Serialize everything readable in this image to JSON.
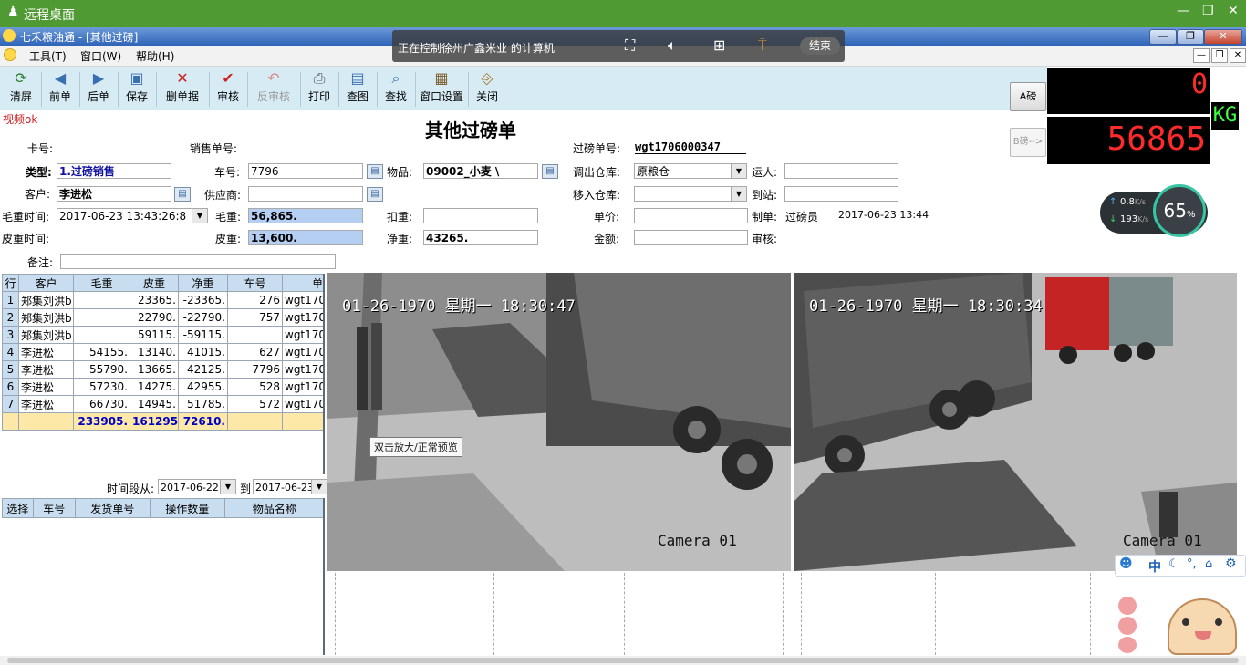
{
  "remote_desktop": {
    "title": "远程桌面",
    "minimize": "—",
    "restore": "❐",
    "close": "✕"
  },
  "app": {
    "title": "七禾粮油通 - [其他过磅]"
  },
  "remote_overlay": {
    "message": "正在控制徐州广鑫米业 的计算机",
    "end_label": "结束"
  },
  "menu": {
    "items": [
      "工具(T)",
      "窗口(W)",
      "帮助(H)"
    ]
  },
  "toolbar": {
    "buttons": [
      {
        "label": "清屏",
        "icon": "refresh-icon"
      },
      {
        "label": "前单",
        "icon": "prev-icon"
      },
      {
        "label": "后单",
        "icon": "next-icon"
      },
      {
        "label": "保存",
        "icon": "save-icon"
      },
      {
        "label": "删单据",
        "icon": "delete-icon"
      },
      {
        "label": "审核",
        "icon": "check-icon"
      },
      {
        "label": "反审核",
        "icon": "undo-icon"
      },
      {
        "label": "打印",
        "icon": "print-icon"
      },
      {
        "label": "查图",
        "icon": "image-icon"
      },
      {
        "label": "查找",
        "icon": "search-icon"
      },
      {
        "label": "窗口设置",
        "icon": "settings-icon"
      },
      {
        "label": "关闭",
        "icon": "exit-icon"
      }
    ]
  },
  "status": {
    "video": "视频ok"
  },
  "form": {
    "title": "其他过磅单",
    "card_no_label": "卡号:",
    "sales_no_label": "销售单号:",
    "weigh_no_label": "过磅单号:",
    "weigh_no": "wgt1706000347",
    "type_label": "类型:",
    "type_value": "1.过磅销售",
    "plate_label": "车号:",
    "plate_value": "7796",
    "goods_label": "物品:",
    "goods_value": "09002_小麦 \\",
    "out_wh_label": "调出仓库:",
    "out_wh_value": "原粮仓",
    "carrier_label": "运人:",
    "customer_label": "客户:",
    "customer_value": "李进松",
    "supplier_label": "供应商:",
    "in_wh_label": "移入仓库:",
    "station_label": "到站:",
    "gross_time_label": "毛重时间:",
    "gross_time_value": "2017-06-23 13:43:26:8",
    "gross_label": "毛重:",
    "gross_value": "56,865.",
    "deduct_label": "扣重:",
    "price_label": "单价:",
    "maker_label": "制单:",
    "maker_value": "过磅员",
    "maker_time": "2017-06-23 13:44",
    "tare_time_label": "皮重时间:",
    "tare_label": "皮重:",
    "tare_value": "13,600.",
    "net_label": "净重:",
    "net_value": "43265.",
    "amount_label": "金额:",
    "review_label": "审核:",
    "remark_label": "备注:"
  },
  "scale": {
    "a_button": "A磅",
    "b_button": "B磅-->",
    "top_value": "0",
    "main_value": "56865",
    "unit": "KG"
  },
  "net_widget": {
    "up": "0.8",
    "down": "193",
    "unit": "K/s",
    "percent": "65",
    "percent_sign": "%"
  },
  "grid": {
    "headers": [
      "行",
      "客户",
      "毛重",
      "皮重",
      "净重",
      "车号",
      "单"
    ],
    "rows": [
      [
        "1",
        "郑集刘洪b",
        "",
        "23365.",
        "-23365.",
        "276",
        "wgt170"
      ],
      [
        "2",
        "郑集刘洪b",
        "",
        "22790.",
        "-22790.",
        "757",
        "wgt170"
      ],
      [
        "3",
        "郑集刘洪b",
        "",
        "59115.",
        "-59115.",
        "",
        "wgt170"
      ],
      [
        "4",
        "李进松",
        "54155.",
        "13140.",
        "41015.",
        "627",
        "wgt170"
      ],
      [
        "5",
        "李进松",
        "55790.",
        "13665.",
        "42125.",
        "7796",
        "wgt170"
      ],
      [
        "6",
        "李进松",
        "57230.",
        "14275.",
        "42955.",
        "528",
        "wgt170"
      ],
      [
        "7",
        "李进松",
        "66730.",
        "14945.",
        "51785.",
        "572",
        "wgt170"
      ]
    ],
    "totals": [
      "",
      "",
      "233905.",
      "161295.",
      "72610.",
      "",
      ""
    ]
  },
  "period": {
    "label": "时间段从:",
    "from": "2017-06-22",
    "to_label": "到",
    "to": "2017-06-23"
  },
  "grid2": {
    "headers": [
      "选择",
      "车号",
      "发货单号",
      "操作数量",
      "物品名称"
    ]
  },
  "video": {
    "cam1": {
      "timestamp": "01-26-1970 星期一 18:30:47",
      "label": "Camera 01"
    },
    "cam2": {
      "timestamp": "01-26-1970 星期一 18:30:34",
      "label": "Camera 01"
    },
    "tooltip": "双击放大/正常预览"
  },
  "ime": {
    "label": "中"
  }
}
